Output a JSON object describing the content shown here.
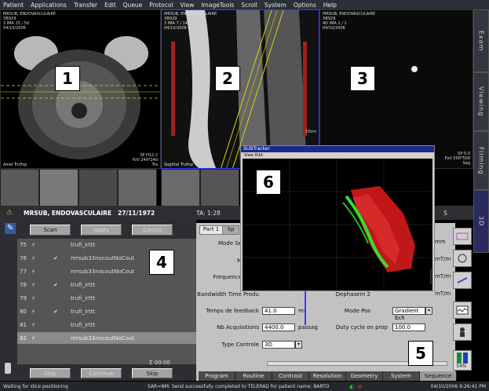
{
  "menubar": [
    "Patient",
    "Applications",
    "Transfer",
    "Edit",
    "Queue",
    "Protocol",
    "View",
    "ImageTools",
    "Scroll",
    "System",
    "Options",
    "Help"
  ],
  "viewports": [
    {
      "id": "1",
      "header": "MRSUB, ENDOVASCULAIRE\nXB929\n2 IMA 25 / 50\n04/10/2006",
      "footer": "Axial Trufisp",
      "corner": "SP H12.2\nFoV 249*240\nTra"
    },
    {
      "id": "2",
      "header": "MRSUB, ENDOVASCULAIRE\nXB929\n3 IMA 7 / 14\n04/10/2006",
      "footer": "Sagittal Trufisp",
      "corner": "10cm"
    },
    {
      "id": "3",
      "header": "MRSUB, ENDOVASCULAIRE\nXB929\n4D IMA 1 / 1\n04/10/2006",
      "footer": "",
      "corner": "SP 0.0\nFoV 500*500\nSag"
    }
  ],
  "badges": [
    "1",
    "2",
    "3",
    "4",
    "5",
    "6"
  ],
  "right_tabs": [
    "Exam",
    "Viewing",
    "Filming",
    "3D"
  ],
  "patient_bar": {
    "name": "MRSUB, ENDOVASCULAIRE",
    "dob": "27/11/1972",
    "ta": "TA: 1:28",
    "s": "S"
  },
  "queue_buttons": {
    "scan": "Scan",
    "apply": "Apply",
    "cancel": "Cancel"
  },
  "queue": [
    {
      "num": "75",
      "check": false,
      "name": "trufi_irttt"
    },
    {
      "num": "76",
      "check": true,
      "name": "mrsub33nocoutNoCout"
    },
    {
      "num": "77",
      "check": false,
      "name": "mrsub33nocoutNoCout"
    },
    {
      "num": "78",
      "check": true,
      "name": "trufi_irttt"
    },
    {
      "num": "79",
      "check": false,
      "name": "trufi_irttt"
    },
    {
      "num": "80",
      "check": true,
      "name": "trufi_irttt"
    },
    {
      "num": "81",
      "check": false,
      "name": "trufi_irttt"
    },
    {
      "num": "82",
      "check": false,
      "name": "mrsub33nocoutNoCout"
    }
  ],
  "timer": "Σ 00:00",
  "bottom_buttons": {
    "stop": "Stop",
    "continue": "Continue",
    "skip": "Skip"
  },
  "protocol_tabs": [
    "Part 1",
    "Sp"
  ],
  "params_left": [
    {
      "label": "Mode Se",
      "value": ""
    },
    {
      "label": "M",
      "value": ""
    },
    {
      "label": "Frequence",
      "value": ""
    },
    {
      "label": "Bandwidth Time Produ",
      "value": ""
    },
    {
      "label": "Temps de feedback",
      "value": "41.0",
      "unit": "ms"
    },
    {
      "label": "Nb Acquisitions",
      "value": "4400.0",
      "unit": "passag"
    },
    {
      "label": "Type Controle",
      "value": "3D"
    }
  ],
  "params_right": [
    {
      "label": "Dephasem 2",
      "value": ""
    },
    {
      "label": "Mode Pos",
      "value": "Gradient Ech"
    },
    {
      "label": "Duty cycle on prop",
      "value": "100.0"
    }
  ],
  "right_units": [
    "mm",
    "mT/m",
    "mT/m",
    "mT/m"
  ],
  "popup": {
    "title": "SUBTracker",
    "menu": [
      "View",
      "Edit"
    ]
  },
  "bottom_tabs": [
    "Program",
    "Routine",
    "Contrast",
    "Resolution",
    "Geometry",
    "System",
    "Sequence"
  ],
  "status": {
    "left": "Waiting for slice positioning",
    "message": "SAR=NM: Send successfully completed to TELERAD for patient name: BARTO",
    "datetime": "04/10/2006 9:26:41 PM"
  },
  "sar_percent": "34%",
  "colors": {
    "accent_blue": "#3a3aff",
    "panel_gray": "#c2c2c2",
    "red_trace": "#e02020",
    "green_trace": "#20e020"
  }
}
